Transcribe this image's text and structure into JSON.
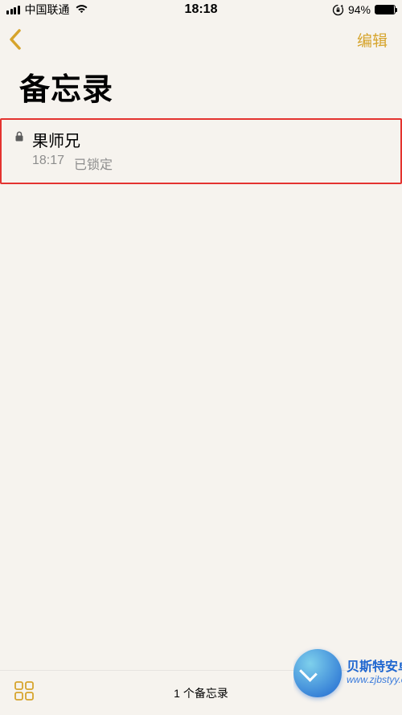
{
  "status_bar": {
    "carrier": "中国联通",
    "time": "18:18",
    "battery_pct": "94%"
  },
  "nav": {
    "edit_label": "编辑"
  },
  "header": {
    "title": "备忘录"
  },
  "notes": {
    "item0": {
      "title": "果师兄",
      "time": "18:17",
      "status": "已锁定"
    }
  },
  "toolbar": {
    "count_label": "1 个备忘录"
  },
  "watermark": {
    "name": "贝斯特安卓网",
    "url": "www.zjbstyy.com"
  }
}
